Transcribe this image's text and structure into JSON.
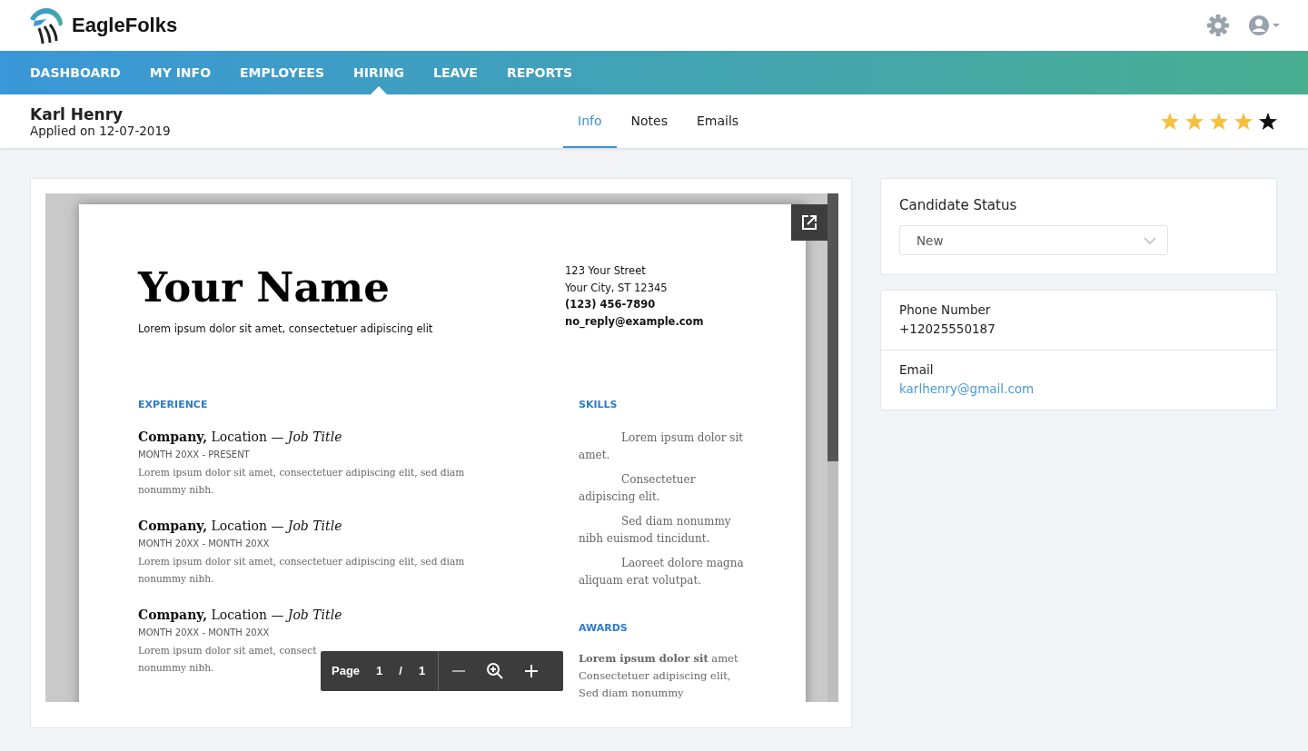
{
  "app": {
    "name": "EagleFolks"
  },
  "nav": [
    {
      "label": "DASHBOARD",
      "selected": false
    },
    {
      "label": "MY INFO",
      "selected": false
    },
    {
      "label": "EMPLOYEES",
      "selected": false
    },
    {
      "label": "HIRING",
      "selected": true
    },
    {
      "label": "LEAVE",
      "selected": false
    },
    {
      "label": "REPORTS",
      "selected": false
    }
  ],
  "candidate": {
    "name": "Karl Henry",
    "applied": "Applied on 12-07-2019",
    "stars": 4
  },
  "tabs": [
    {
      "label": "Info",
      "selected": true
    },
    {
      "label": "Notes",
      "selected": false
    },
    {
      "label": "Emails",
      "selected": false
    }
  ],
  "resume": {
    "name": "Your Name",
    "tagline": "Lorem ipsum dolor sit amet, consectetuer adipiscing elit",
    "address": [
      {
        "text": "123 Your Street",
        "bold": false
      },
      {
        "text": "Your City, ST 12345",
        "bold": false
      },
      {
        "text": "(123) 456-7890",
        "bold": true
      },
      {
        "text": "no_reply@example.com",
        "bold": true
      }
    ],
    "experience": {
      "heading": "EXPERIENCE",
      "jobs": [
        {
          "title": "**Company,** Location — *Job Title*",
          "dates": "MONTH 20XX - PRESENT",
          "lines": [
            "Lorem ipsum dolor sit amet, consectetuer adipiscing elit, sed diam",
            "nonummy nibh."
          ]
        },
        {
          "title": "**Company,** Location — *Job Title*",
          "dates": "MONTH 20XX - MONTH 20XX",
          "lines": [
            "Lorem ipsum dolor sit amet, consectetuer adipiscing elit, sed diam",
            "nonummy nibh."
          ]
        },
        {
          "title": "**Company,** Location — *Job Title*",
          "dates": "MONTH 20XX - MONTH 20XX",
          "lines": [
            "Lorem ipsum dolor sit amet, consect",
            "nonummy nibh."
          ]
        }
      ]
    },
    "skills": {
      "heading": "SKILLS",
      "items": [
        "Lorem ipsum dolor sit amet.",
        "Consectetuer adipiscing elit.",
        "Sed diam nonummy nibh euismod tincidunt.",
        "Laoreet dolore magna aliquam erat volutpat."
      ]
    },
    "awards": {
      "heading": "AWARDS",
      "lines": [
        "**Lorem ipsum dolor sit** amet",
        "Consectetuer adipiscing elit,",
        "Sed diam nonummy"
      ]
    }
  },
  "viewer": {
    "page_label": "Page",
    "page": "1",
    "separator": "/",
    "total": "1"
  },
  "status": {
    "title": "Candidate Status",
    "value": "New"
  },
  "contact": [
    {
      "label": "Phone Number",
      "value": "+12025550187",
      "kind": "text"
    },
    {
      "label": "Email",
      "value": "karlhenry@gmail.com",
      "kind": "link"
    }
  ]
}
